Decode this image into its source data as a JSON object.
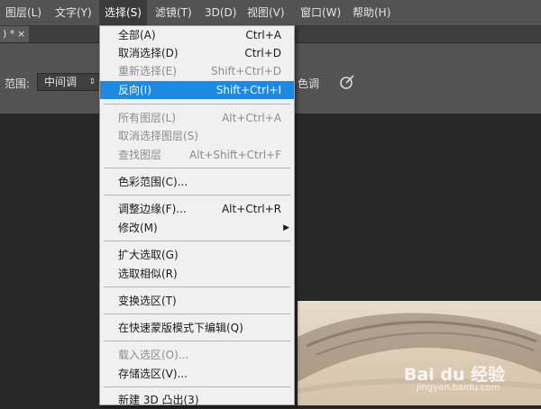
{
  "menubar": [
    {
      "label": "图层(L)"
    },
    {
      "label": "文字(Y)"
    },
    {
      "label": "选择(S)"
    },
    {
      "label": "滤镜(T)"
    },
    {
      "label": "3D(D)"
    },
    {
      "label": "视图(V)"
    },
    {
      "label": "窗口(W)"
    },
    {
      "label": "帮助(H)"
    }
  ],
  "tab": {
    "label": ") *",
    "close": "×"
  },
  "options": {
    "range_label": "范围:",
    "range_value": "中间调",
    "range_arrow": "⇕",
    "tail_text": "色调"
  },
  "select_menu": [
    {
      "label": "全部(A)",
      "shortcut": "Ctrl+A"
    },
    {
      "label": "取消选择(D)",
      "shortcut": "Ctrl+D"
    },
    {
      "label": "重新选择(E)",
      "shortcut": "Shift+Ctrl+D",
      "state": "disabled"
    },
    {
      "label": "反向(I)",
      "shortcut": "Shift+Ctrl+I",
      "state": "highlighted"
    },
    {
      "label": "所有图层(L)",
      "shortcut": "Alt+Ctrl+A",
      "state": "disabled"
    },
    {
      "label": "取消选择图层(S)",
      "shortcut": "",
      "state": "disabled"
    },
    {
      "label": "查找图层",
      "shortcut": "Alt+Shift+Ctrl+F",
      "state": "disabled"
    },
    {
      "label": "色彩范围(C)...",
      "shortcut": ""
    },
    {
      "label": "调整边缘(F)...",
      "shortcut": "Alt+Ctrl+R"
    },
    {
      "label": "修改(M)",
      "shortcut": "",
      "submenu": "▶"
    },
    {
      "label": "扩大选取(G)",
      "shortcut": ""
    },
    {
      "label": "选取相似(R)",
      "shortcut": ""
    },
    {
      "label": "变换选区(T)",
      "shortcut": ""
    },
    {
      "label": "在快速蒙版模式下编辑(Q)",
      "shortcut": ""
    },
    {
      "label": "载入选区(O)...",
      "shortcut": "",
      "state": "disabled"
    },
    {
      "label": "存储选区(V)...",
      "shortcut": ""
    },
    {
      "label": "新建 3D 凸出(3)",
      "shortcut": ""
    }
  ],
  "watermark": {
    "text": "Bai du 经验",
    "sub": "jingyan.baidu.com"
  },
  "colors": {
    "highlight": "#1e88e5",
    "menubar": "#535353",
    "menu_bg": "#f0f0f0"
  }
}
